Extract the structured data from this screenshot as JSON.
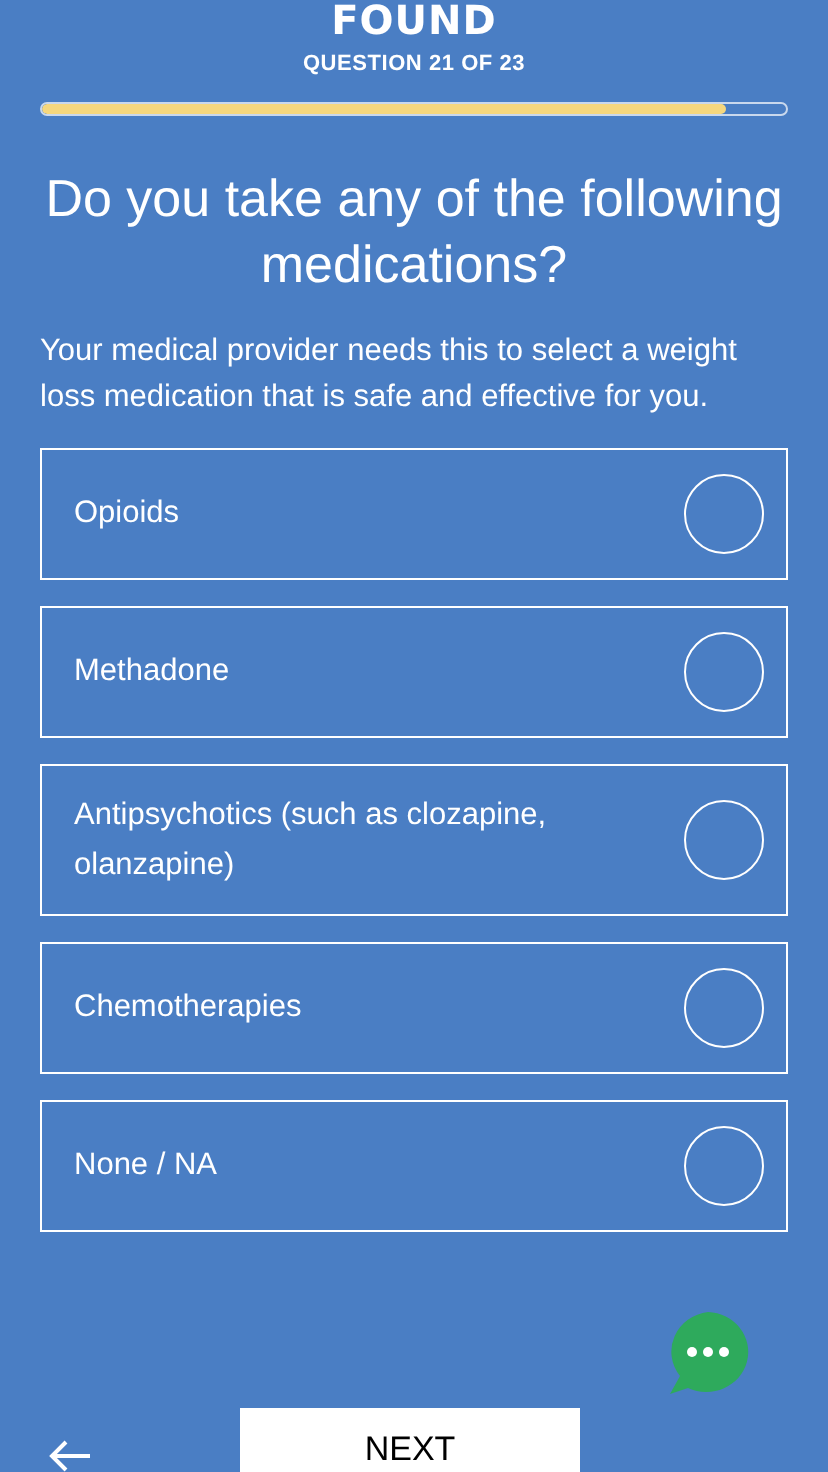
{
  "logo": "FOUND",
  "progress": {
    "label": "QUESTION 21 OF 23",
    "level": 0.92
  },
  "question": "Do you take any of the following medications?",
  "description": "Your medical provider needs this to select a weight loss medication that is safe and effective for you.",
  "options": [
    {
      "label": "Opioids",
      "selected": false
    },
    {
      "label": "Methadone",
      "selected": false
    },
    {
      "label": "Antipsychotics (such as clozapine, olanzapine)",
      "selected": false
    },
    {
      "label": "Chemotherapies",
      "selected": false
    },
    {
      "label": "None / NA",
      "selected": false
    }
  ],
  "next_button": "NEXT"
}
